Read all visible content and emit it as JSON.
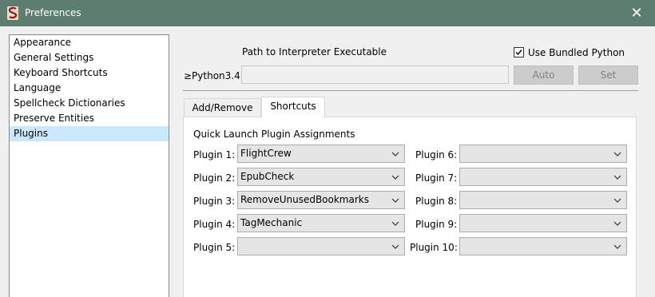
{
  "window": {
    "title": "Preferences",
    "title_bar_color": "#5c7d6f",
    "close_glyph": "✕"
  },
  "categories": [
    {
      "label": "Appearance",
      "selected": false
    },
    {
      "label": "General Settings",
      "selected": false
    },
    {
      "label": "Keyboard Shortcuts",
      "selected": false
    },
    {
      "label": "Language",
      "selected": false
    },
    {
      "label": "Spellcheck Dictionaries",
      "selected": false
    },
    {
      "label": "Preserve Entities",
      "selected": false
    },
    {
      "label": "Plugins",
      "selected": true
    }
  ],
  "interpreter": {
    "path_label": "Path to Interpreter Executable",
    "use_bundled_label": "Use Bundled Python",
    "use_bundled_checked": true,
    "python_label": "≥Python3.4:",
    "path_value": "",
    "auto_label": "Auto",
    "set_label": "Set"
  },
  "tabs": [
    {
      "label": "Add/Remove",
      "active": false
    },
    {
      "label": "Shortcuts",
      "active": true
    }
  ],
  "shortcuts": {
    "title": "Quick Launch Plugin Assignments",
    "plugins": [
      {
        "label": "Plugin 1:",
        "value": "FlightCrew"
      },
      {
        "label": "Plugin 2:",
        "value": "EpubCheck"
      },
      {
        "label": "Plugin 3:",
        "value": "RemoveUnusedBookmarks"
      },
      {
        "label": "Plugin 4:",
        "value": "TagMechanic"
      },
      {
        "label": "Plugin 5:",
        "value": ""
      },
      {
        "label": "Plugin 6:",
        "value": ""
      },
      {
        "label": "Plugin 7:",
        "value": ""
      },
      {
        "label": "Plugin 8:",
        "value": ""
      },
      {
        "label": "Plugin 9:",
        "value": ""
      },
      {
        "label": "Plugin 10:",
        "value": ""
      }
    ]
  },
  "colors": {
    "selection": "#cce8ff",
    "disabled_button": "#cccccc"
  }
}
